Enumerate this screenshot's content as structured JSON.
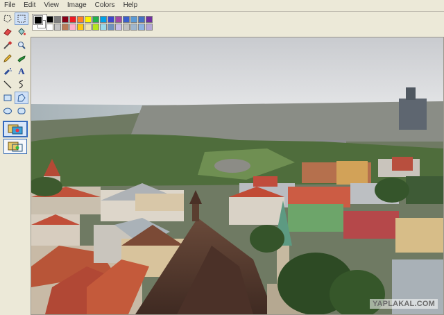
{
  "menu": [
    "File",
    "Edit",
    "View",
    "Image",
    "Colors",
    "Help"
  ],
  "toolbox": {
    "tools": [
      {
        "name": "free-form-select-icon"
      },
      {
        "name": "rect-select-icon",
        "selected": true
      },
      {
        "name": "eraser-icon"
      },
      {
        "name": "fill-bucket-icon"
      },
      {
        "name": "eyedropper-icon"
      },
      {
        "name": "magnifier-icon"
      },
      {
        "name": "pencil-icon"
      },
      {
        "name": "brush-icon"
      },
      {
        "name": "airbrush-icon"
      },
      {
        "name": "text-icon"
      },
      {
        "name": "line-icon"
      },
      {
        "name": "curve-icon"
      },
      {
        "name": "rectangle-icon"
      },
      {
        "name": "polygon-icon"
      },
      {
        "name": "ellipse-icon"
      },
      {
        "name": "rounded-rect-icon"
      }
    ],
    "text_tool_glyph": "A",
    "options": [
      {
        "name": "opaque-selection-option",
        "selected": true
      },
      {
        "name": "transparent-selection-option",
        "selected": false
      }
    ]
  },
  "palette": {
    "foreground": "#000000",
    "background": "#ffffff",
    "row1": [
      "#000000",
      "#7f7f7f",
      "#880015",
      "#ed1c24",
      "#ff7f27",
      "#fff200",
      "#22b14c",
      "#00a2e8",
      "#3f48cc",
      "#a349a4",
      "#3a5fcd",
      "#5b9bd5",
      "#4472c4",
      "#7030a0"
    ],
    "row2": [
      "#ffffff",
      "#c3c3c3",
      "#b97a57",
      "#ffaec9",
      "#ffc90e",
      "#efe4b0",
      "#b5e61d",
      "#99d9ea",
      "#7092be",
      "#c8bfe7",
      "#c0c0c0",
      "#9fb6cd",
      "#8db3e2",
      "#b4a7d6"
    ]
  },
  "canvas": {
    "description": "aerial-city-photo",
    "watermark": "YAPLAKAL.COM"
  }
}
